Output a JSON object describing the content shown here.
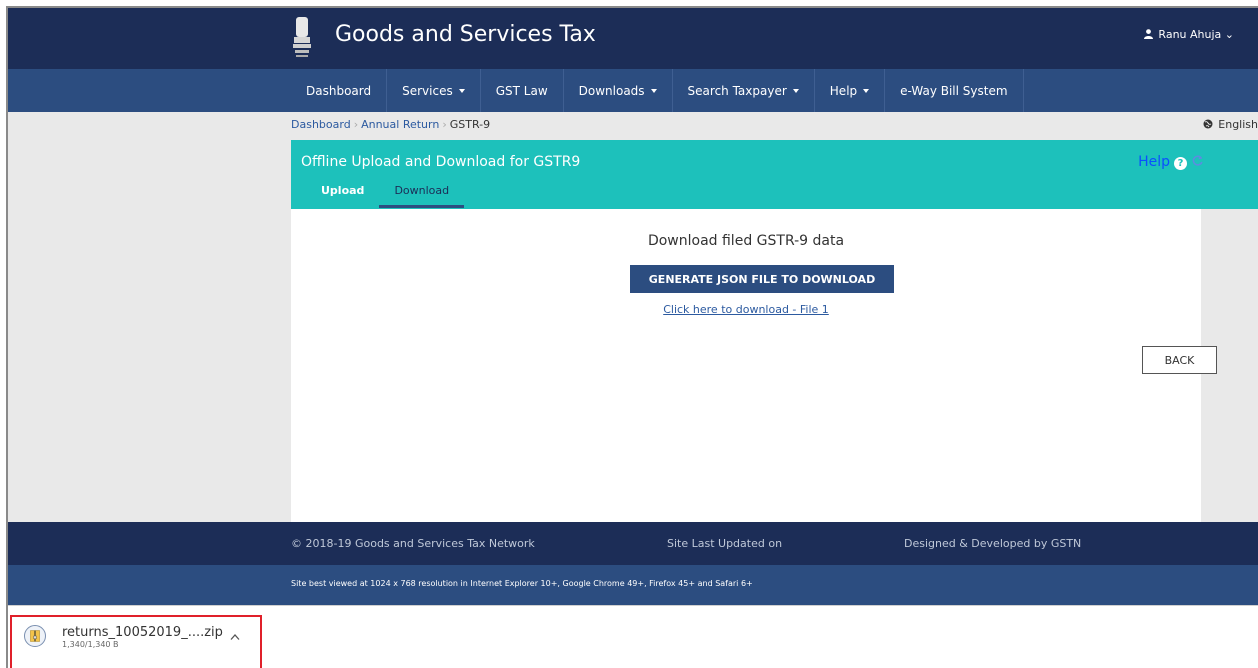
{
  "header": {
    "site_title": "Goods and Services Tax",
    "user_name": "Ranu Ahuja",
    "user_caret": "⌄"
  },
  "nav": {
    "items": [
      {
        "label": "Dashboard",
        "has_caret": false
      },
      {
        "label": "Services",
        "has_caret": true
      },
      {
        "label": "GST Law",
        "has_caret": false
      },
      {
        "label": "Downloads",
        "has_caret": true
      },
      {
        "label": "Search Taxpayer",
        "has_caret": true
      },
      {
        "label": "Help",
        "has_caret": true
      },
      {
        "label": "e-Way Bill System",
        "has_caret": false
      }
    ]
  },
  "breadcrumb": {
    "items": [
      "Dashboard",
      "Annual Return",
      "GSTR-9"
    ]
  },
  "language": "English",
  "panel": {
    "title": "Offline Upload and Download for GSTR9",
    "help_label": "Help",
    "tabs": {
      "upload": "Upload",
      "download": "Download"
    },
    "heading": "Download filed GSTR-9 data",
    "generate_button": "GENERATE JSON FILE TO DOWNLOAD",
    "download_link": "Click here to download - File 1",
    "back_button": "BACK"
  },
  "footer": {
    "copyright": "© 2018-19 Goods and Services Tax Network",
    "updated": "Site Last Updated on",
    "developer": "Designed & Developed by GSTN",
    "best_viewed": "Site best viewed at 1024 x 768 resolution in Internet Explorer 10+, Google Chrome 49+, Firefox 45+ and Safari 6+"
  },
  "download_bar": {
    "file_name": "returns_10052019_....zip",
    "file_size": "1,340/1,340 B"
  },
  "colors": {
    "header_bg": "#1c2d57",
    "nav_bg": "#2c4d80",
    "panel_teal": "#1dc1bb",
    "highlight_red": "#e0202a"
  }
}
